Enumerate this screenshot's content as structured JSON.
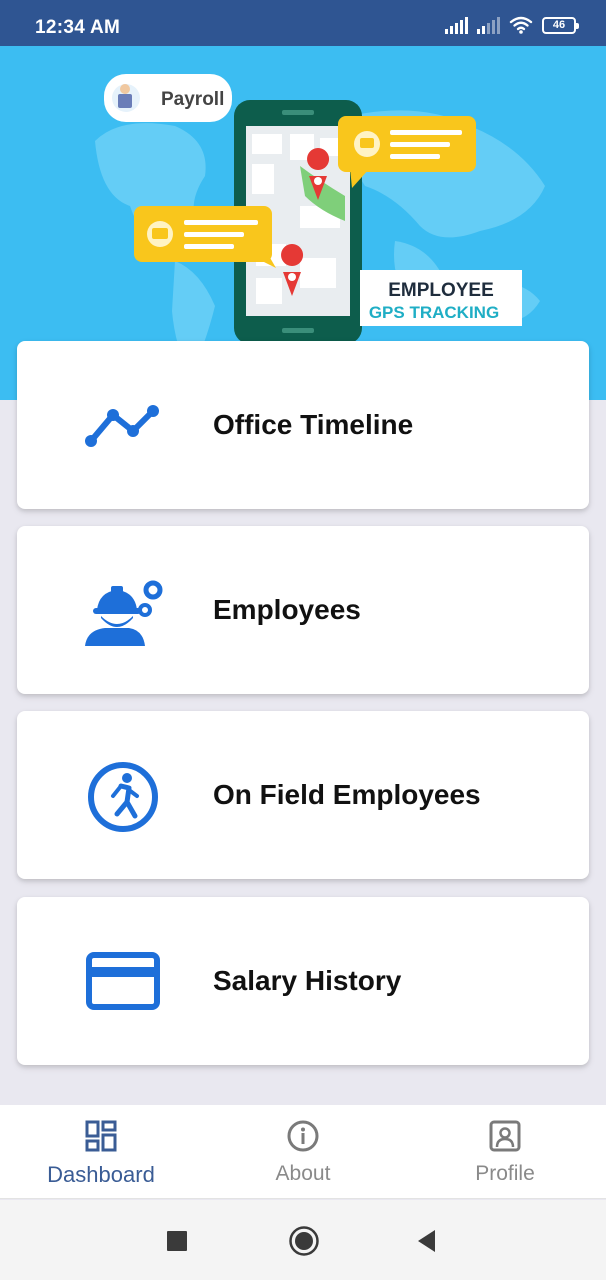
{
  "status_bar": {
    "time": "12:34 AM",
    "battery": "46",
    "icons": [
      "signal-icon",
      "signal-icon",
      "wifi-icon",
      "battery-icon"
    ]
  },
  "hero": {
    "payroll_label": "Payroll",
    "title_line1": "EMPLOYEE",
    "title_line2": "GPS TRACKING",
    "colors": {
      "background": "#3cbdf2",
      "phone": "#0d5d4c",
      "bubble": "#f9c61c",
      "pin": "#e53935"
    }
  },
  "menu": {
    "items": [
      {
        "label": "Office Timeline",
        "icon": "timeline-icon"
      },
      {
        "label": "Employees",
        "icon": "employee-gear-icon"
      },
      {
        "label": "On Field Employees",
        "icon": "running-person-icon"
      },
      {
        "label": "Salary History",
        "icon": "credit-card-icon"
      }
    ],
    "icon_color": "#1e6fd9"
  },
  "bottom_nav": {
    "items": [
      {
        "label": "Dashboard",
        "icon": "dashboard-icon",
        "active": true
      },
      {
        "label": "About",
        "icon": "info-icon",
        "active": false
      },
      {
        "label": "Profile",
        "icon": "profile-icon",
        "active": false
      }
    ],
    "active_color": "#3a5c95"
  },
  "system_nav": {
    "icons": [
      "recents-square-icon",
      "home-circle-icon",
      "back-triangle-icon"
    ]
  }
}
